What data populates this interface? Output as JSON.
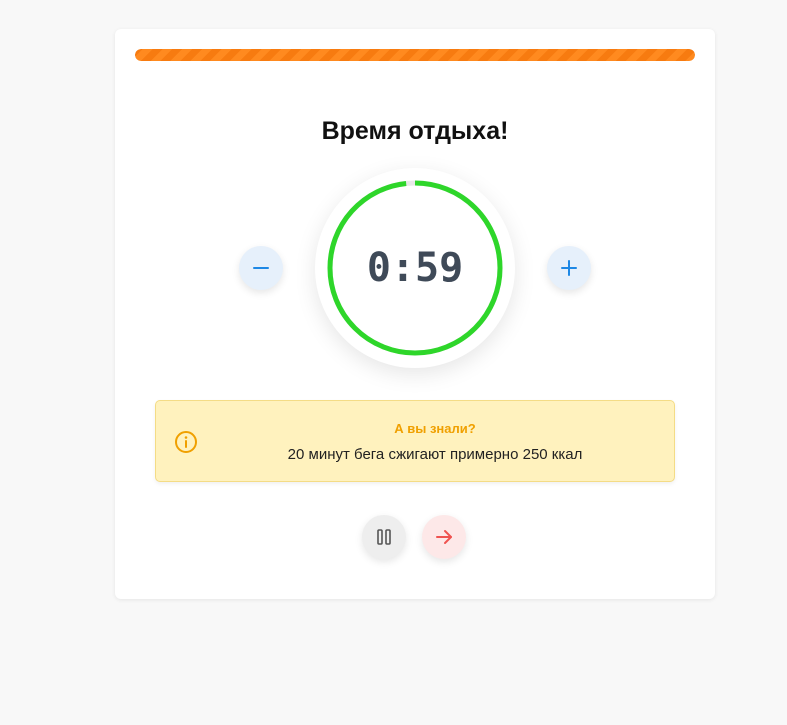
{
  "progress": {
    "fraction": 1.0,
    "color": "#ff8a1f"
  },
  "title": "Время отдыха!",
  "timer": {
    "display": "0:59",
    "remaining_fraction": 0.983,
    "ring_color": "#2ed62a",
    "track_color": "#e8e8e8"
  },
  "controls": {
    "decrease_icon": "minus-icon",
    "increase_icon": "plus-icon",
    "pause_icon": "pause-icon",
    "skip_icon": "arrow-right-icon"
  },
  "tip": {
    "icon": "info-icon",
    "title": "А вы знали?",
    "text": "20 минут бега сжигают примерно 250 ккал"
  },
  "colors": {
    "accent_blue": "#1e88e5",
    "warning": "#f0a000",
    "danger": "#ef5350"
  }
}
